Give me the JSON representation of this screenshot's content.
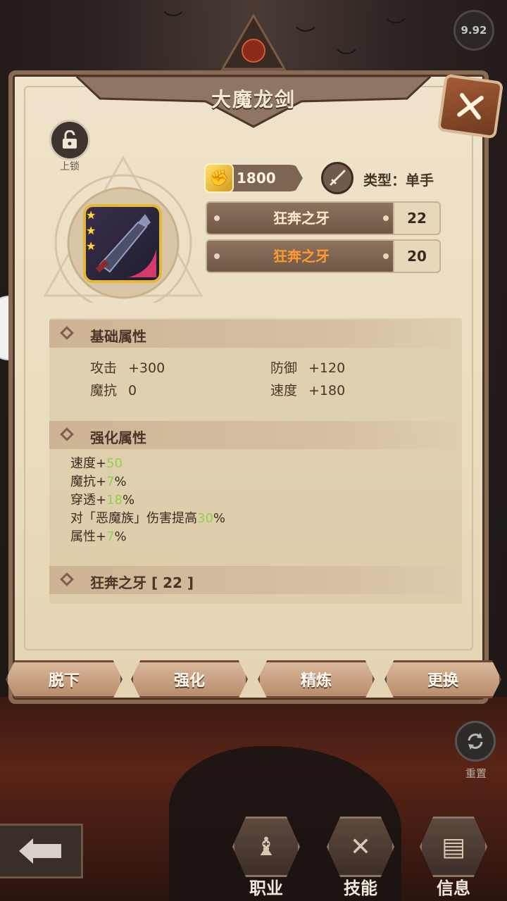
{
  "status": {
    "version": "9.92"
  },
  "panel": {
    "title": "大魔龙剑",
    "lock_label": "上锁",
    "cost": "1800",
    "type_label": "类型：单手",
    "skills": [
      {
        "name": "狂奔之牙",
        "level": "22",
        "color": "#ffe9c9"
      },
      {
        "name": "狂奔之牙",
        "level": "20",
        "color": "#ff9a2e"
      }
    ],
    "stars": 3
  },
  "basic": {
    "title": "基础属性",
    "stats": [
      {
        "name": "攻击",
        "value": "+300"
      },
      {
        "name": "防御",
        "value": "+120"
      },
      {
        "name": "魔抗",
        "value": "0"
      },
      {
        "name": "速度",
        "value": "+180"
      }
    ]
  },
  "enhance": {
    "title": "强化属性",
    "lines": [
      {
        "pre": "速度+",
        "num": "50",
        "post": ""
      },
      {
        "pre": "魔抗+",
        "num": "7",
        "post": "%"
      },
      {
        "pre": "穿透+",
        "num": "18",
        "post": "%"
      },
      {
        "pre": "对「恶魔族」伤害提高",
        "num": "30",
        "post": "%"
      },
      {
        "pre": "属性+",
        "num": "7",
        "post": "%"
      }
    ]
  },
  "skill_section": {
    "title": "狂奔之牙 [ 22 ]"
  },
  "actions": {
    "unequip": "脱下",
    "enhance": "强化",
    "refine": "精炼",
    "replace": "更换"
  },
  "reset": {
    "label": "重置"
  },
  "nav": {
    "class": "职业",
    "skills": "技能",
    "info": "信息"
  },
  "colors": {
    "accent_green": "#8fd24a",
    "skill_orange": "#ff9a2e",
    "panel_bg": "#efe3cb"
  }
}
